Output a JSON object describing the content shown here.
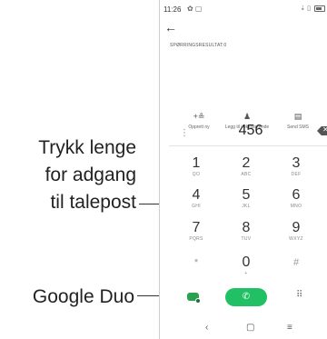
{
  "annotations": {
    "voicemail": [
      "Trykk lenge",
      "for adgang",
      "til talepost"
    ],
    "duo": "Google Duo"
  },
  "status_bar": {
    "time": "11:26",
    "icons": "✿ ▢",
    "right": "⇣ ▯"
  },
  "back_icon": "←",
  "search_results": "SPØRRINGSRESULTAT:0",
  "actions": [
    {
      "icon": "person-add-icon",
      "glyph": "+≗",
      "label": "Opprett ny"
    },
    {
      "icon": "person-icon",
      "glyph": "♟",
      "label": "Legg til i eksisterende"
    },
    {
      "icon": "message-icon",
      "glyph": "▤",
      "label": "Send SMS"
    }
  ],
  "entry": {
    "number": "456",
    "menu_glyph": "⋮",
    "backspace_glyph": "✕"
  },
  "keys": [
    {
      "digit": "1",
      "letters": "QO"
    },
    {
      "digit": "2",
      "letters": "ABC"
    },
    {
      "digit": "3",
      "letters": "DEF"
    },
    {
      "digit": "4",
      "letters": "GHI"
    },
    {
      "digit": "5",
      "letters": "JKL"
    },
    {
      "digit": "6",
      "letters": "MNO"
    },
    {
      "digit": "7",
      "letters": "PQRS"
    },
    {
      "digit": "8",
      "letters": "TUV"
    },
    {
      "digit": "9",
      "letters": "WXYZ"
    },
    {
      "digit": "*",
      "letters": ""
    },
    {
      "digit": "0",
      "letters": "+"
    },
    {
      "digit": "#",
      "letters": ""
    }
  ],
  "bottom": {
    "call_glyph": "✆",
    "dialpad_glyph": "⠿"
  },
  "nav": {
    "back": "‹",
    "home": "▢",
    "recents": "≡"
  },
  "colors": {
    "call_green": "#22c064",
    "duo_green": "#2aa14c"
  }
}
